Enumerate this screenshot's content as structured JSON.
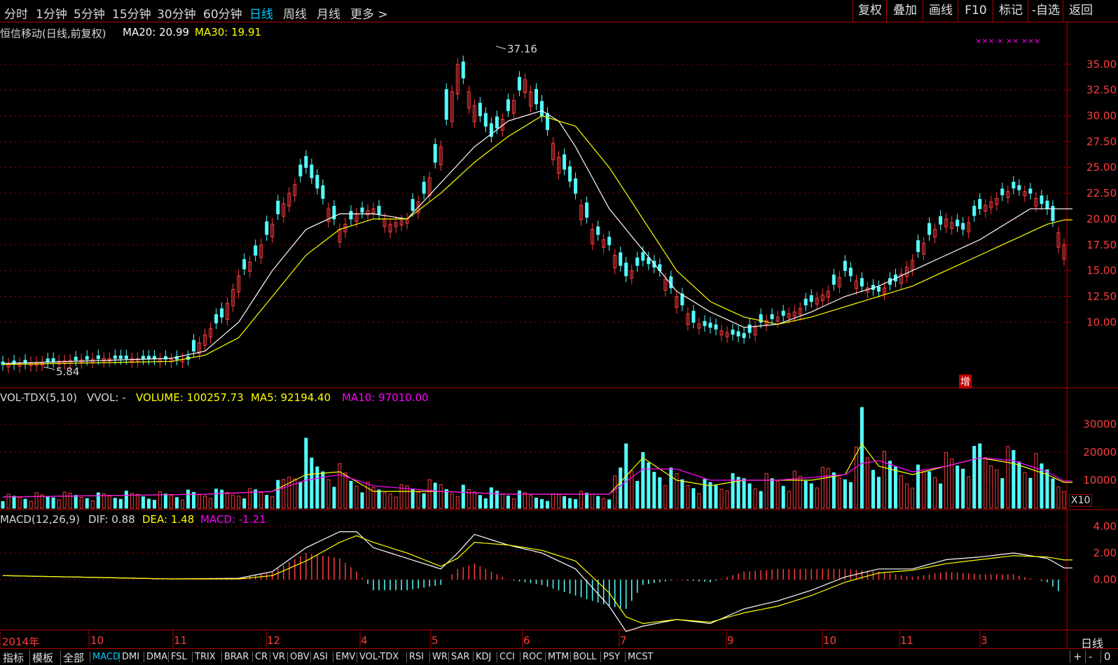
{
  "topbar": {
    "periods": [
      "分时",
      "1分钟",
      "5分钟",
      "15分钟",
      "30分钟",
      "60分钟",
      "日线",
      "周线",
      "月线",
      "更多 >"
    ],
    "active_period": "日线",
    "tools": [
      "复权",
      "叠加",
      "画线",
      "F10",
      "标记",
      "-自选",
      "返回"
    ]
  },
  "price_panel": {
    "title": "恒信移动(日线,前复权)",
    "ma20_label": "MA20: 20.99",
    "ma30_label": "MA30: 19.91",
    "high_label": "37.16",
    "low_label": "5.84",
    "zeng_label": "增",
    "marker_label": "×××  ×  ××  ×××",
    "y_ticks": [
      "35.00",
      "32.50",
      "30.00",
      "27.50",
      "25.00",
      "22.50",
      "20.00",
      "17.50",
      "15.00",
      "12.50",
      "10.00"
    ]
  },
  "vol_panel": {
    "title": "VOL-TDX(5,10)",
    "vvol": "VVOL: -",
    "volume": "VOLUME: 100257.73",
    "ma5": "MA5: 92194.40",
    "ma10": "MA10: 97010.00",
    "y_ticks": [
      "30000",
      "20000",
      "10000"
    ],
    "unit": "X10"
  },
  "macd_panel": {
    "title": "MACD(12,26,9)",
    "dif": "DIF: 0.88",
    "dea": "DEA: 1.48",
    "macd": "MACD: -1.21",
    "y_ticks": [
      "4.00",
      "2.00",
      "0.00"
    ]
  },
  "x_axis": {
    "labels": [
      "2014年",
      "10",
      "11",
      "12",
      "4",
      "5",
      "6",
      "7",
      "9",
      "10",
      "11",
      "3"
    ],
    "period": "日线"
  },
  "bottom_tabs": [
    "指标",
    "模板",
    "全部",
    "MACD",
    "DMI",
    "DMA",
    "FSL",
    "TRIX",
    "BRAR",
    "CR",
    "VR",
    "OBV",
    "ASI",
    "EMV",
    "VOL-TDX",
    "RSI",
    "WR",
    "SAR",
    "KDJ",
    "CCI",
    "ROC",
    "MTM",
    "BOLL",
    "PSY",
    "MCST"
  ],
  "active_tab": "MACD",
  "bottom_right": [
    "+",
    "-",
    "0"
  ],
  "colors": {
    "up": "#ff3c3c",
    "down": "#54ffff",
    "ma20": "#ffffff",
    "ma30": "#ffff00",
    "ma10": "#ff00ff",
    "grid": "#a00000"
  },
  "chart_data": [
    {
      "type": "candlestick",
      "series_name": "恒信移动",
      "ylim": [
        5.84,
        37.16
      ],
      "close_path": [
        [
          0,
          5.9
        ],
        [
          6,
          6.5
        ],
        [
          11,
          6.4
        ],
        [
          12,
          8.8
        ],
        [
          13,
          10.5
        ],
        [
          14,
          14.5
        ],
        [
          15,
          16.5
        ],
        [
          16,
          19.5
        ],
        [
          17,
          22.5
        ],
        [
          18,
          25.0
        ],
        [
          19,
          22.0
        ],
        [
          20,
          19.0
        ],
        [
          21,
          20.5
        ],
        [
          22,
          21.0
        ],
        [
          23,
          19.5
        ],
        [
          24,
          20.0
        ],
        [
          25,
          22.5
        ],
        [
          26,
          27.0
        ],
        [
          26.5,
          31.0
        ],
        [
          27,
          35.0
        ],
        [
          28,
          31.0
        ],
        [
          29,
          28.0
        ],
        [
          30,
          30.5
        ],
        [
          31,
          33.5
        ],
        [
          32,
          30.0
        ],
        [
          33,
          26.0
        ],
        [
          34,
          22.5
        ],
        [
          35,
          19.0
        ],
        [
          36,
          17.5
        ],
        [
          37,
          14.5
        ],
        [
          38,
          16.0
        ],
        [
          39,
          15.0
        ],
        [
          40,
          12.5
        ],
        [
          41,
          10.0
        ],
        [
          42,
          9.5
        ],
        [
          43,
          9.0
        ],
        [
          44,
          8.5
        ],
        [
          45,
          10.0
        ],
        [
          46,
          10.5
        ],
        [
          47,
          11.0
        ],
        [
          48,
          12.0
        ],
        [
          49,
          13.0
        ],
        [
          50,
          15.0
        ],
        [
          51,
          13.5
        ],
        [
          52,
          13.0
        ],
        [
          53,
          14.0
        ],
        [
          54,
          16.0
        ],
        [
          55,
          18.5
        ],
        [
          56,
          20.0
        ],
        [
          57,
          19.0
        ],
        [
          58,
          21.0
        ],
        [
          59,
          22.0
        ],
        [
          60,
          23.0
        ],
        [
          61,
          22.5
        ],
        [
          62,
          21.0
        ],
        [
          63,
          17.5
        ]
      ],
      "ma20_path": [
        [
          0,
          6.0
        ],
        [
          10,
          6.5
        ],
        [
          12,
          7.2
        ],
        [
          14,
          10.0
        ],
        [
          16,
          15.0
        ],
        [
          18,
          19.0
        ],
        [
          20,
          20.5
        ],
        [
          22,
          20.5
        ],
        [
          24,
          20.0
        ],
        [
          26,
          23.5
        ],
        [
          28,
          27.0
        ],
        [
          30,
          29.5
        ],
        [
          32,
          30.5
        ],
        [
          33,
          29.5
        ],
        [
          34,
          27.0
        ],
        [
          35,
          24.0
        ],
        [
          36,
          21.0
        ],
        [
          38,
          17.0
        ],
        [
          40,
          13.0
        ],
        [
          42,
          11.0
        ],
        [
          44,
          9.5
        ],
        [
          46,
          9.8
        ],
        [
          48,
          11.0
        ],
        [
          50,
          12.5
        ],
        [
          52,
          13.5
        ],
        [
          54,
          15.0
        ],
        [
          56,
          16.5
        ],
        [
          58,
          18.0
        ],
        [
          60,
          20.0
        ],
        [
          61,
          21.0
        ],
        [
          62,
          21.0
        ],
        [
          63,
          20.99
        ]
      ],
      "ma30_path": [
        [
          0,
          5.9
        ],
        [
          10,
          6.2
        ],
        [
          12,
          6.8
        ],
        [
          14,
          8.5
        ],
        [
          16,
          12.5
        ],
        [
          18,
          16.5
        ],
        [
          20,
          19.0
        ],
        [
          22,
          20.0
        ],
        [
          24,
          20.0
        ],
        [
          26,
          22.5
        ],
        [
          28,
          25.5
        ],
        [
          30,
          28.0
        ],
        [
          32,
          30.0
        ],
        [
          34,
          29.0
        ],
        [
          36,
          25.0
        ],
        [
          38,
          20.0
        ],
        [
          40,
          15.0
        ],
        [
          42,
          12.0
        ],
        [
          44,
          10.5
        ],
        [
          46,
          9.8
        ],
        [
          48,
          10.5
        ],
        [
          50,
          11.5
        ],
        [
          52,
          12.5
        ],
        [
          54,
          13.5
        ],
        [
          56,
          15.0
        ],
        [
          58,
          16.5
        ],
        [
          60,
          18.0
        ],
        [
          62,
          19.5
        ],
        [
          63,
          19.91
        ]
      ],
      "y_ticks": [
        35,
        32.5,
        30,
        27.5,
        25,
        22.5,
        20,
        17.5,
        15,
        12.5,
        10
      ]
    },
    {
      "type": "bar",
      "series_name": "VOLUME",
      "ylim": [
        0,
        37000
      ],
      "y_ticks": [
        30000,
        20000,
        10000
      ],
      "levels": [
        [
          0,
          4000
        ],
        [
          12,
          5000
        ],
        [
          16,
          6000
        ],
        [
          18,
          15000
        ],
        [
          20,
          12000
        ],
        [
          22,
          6000
        ],
        [
          26,
          8000
        ],
        [
          28,
          6000
        ],
        [
          32,
          4000
        ],
        [
          36,
          5000
        ],
        [
          37,
          18000
        ],
        [
          38,
          15000
        ],
        [
          40,
          10000
        ],
        [
          42,
          8000
        ],
        [
          44,
          10000
        ],
        [
          46,
          10000
        ],
        [
          48,
          10000
        ],
        [
          50,
          13000
        ],
        [
          51,
          20000
        ],
        [
          52,
          16000
        ],
        [
          54,
          12000
        ],
        [
          56,
          15000
        ],
        [
          58,
          17000
        ],
        [
          60,
          18000
        ],
        [
          62,
          13000
        ],
        [
          63,
          10026
        ]
      ],
      "spikes": [
        [
          18,
          25000
        ],
        [
          51,
          36000
        ],
        [
          37,
          23000
        ],
        [
          58,
          23000
        ]
      ],
      "ma5_path": [
        [
          0,
          4000
        ],
        [
          12,
          5000
        ],
        [
          16,
          6000
        ],
        [
          18,
          12000
        ],
        [
          20,
          13000
        ],
        [
          22,
          6000
        ],
        [
          26,
          6000
        ],
        [
          30,
          5000
        ],
        [
          36,
          5000
        ],
        [
          38,
          18000
        ],
        [
          40,
          10000
        ],
        [
          42,
          8000
        ],
        [
          44,
          10000
        ],
        [
          46,
          10000
        ],
        [
          48,
          10000
        ],
        [
          50,
          12000
        ],
        [
          51,
          23000
        ],
        [
          52,
          15000
        ],
        [
          54,
          12000
        ],
        [
          56,
          15000
        ],
        [
          58,
          18000
        ],
        [
          60,
          16000
        ],
        [
          62,
          12000
        ],
        [
          63,
          9219
        ]
      ],
      "ma10_path": [
        [
          0,
          4000
        ],
        [
          12,
          5000
        ],
        [
          16,
          6000
        ],
        [
          18,
          10000
        ],
        [
          20,
          12000
        ],
        [
          22,
          8000
        ],
        [
          26,
          6000
        ],
        [
          30,
          5000
        ],
        [
          36,
          5000
        ],
        [
          38,
          14000
        ],
        [
          40,
          14000
        ],
        [
          42,
          10000
        ],
        [
          44,
          10000
        ],
        [
          46,
          10000
        ],
        [
          48,
          11000
        ],
        [
          50,
          12000
        ],
        [
          51,
          16000
        ],
        [
          52,
          17000
        ],
        [
          54,
          13000
        ],
        [
          56,
          15000
        ],
        [
          58,
          18000
        ],
        [
          60,
          17000
        ],
        [
          62,
          13000
        ],
        [
          63,
          9701
        ]
      ]
    },
    {
      "type": "bar",
      "series_name": "MACD",
      "ylim": [
        -4.0,
        4.8
      ],
      "y_ticks": [
        4,
        2,
        0
      ],
      "dif_path": [
        [
          0,
          0.3
        ],
        [
          10,
          0.05
        ],
        [
          14,
          0.1
        ],
        [
          16,
          0.6
        ],
        [
          18,
          2.4
        ],
        [
          20,
          3.6
        ],
        [
          21,
          3.6
        ],
        [
          22,
          2.4
        ],
        [
          24,
          1.6
        ],
        [
          26,
          0.8
        ],
        [
          27,
          2.0
        ],
        [
          28,
          3.4
        ],
        [
          30,
          2.6
        ],
        [
          32,
          2.0
        ],
        [
          34,
          0.8
        ],
        [
          36,
          -2.0
        ],
        [
          37,
          -3.9
        ],
        [
          38,
          -3.5
        ],
        [
          40,
          -3.0
        ],
        [
          42,
          -3.3
        ],
        [
          44,
          -2.2
        ],
        [
          46,
          -1.6
        ],
        [
          48,
          -0.8
        ],
        [
          50,
          0.2
        ],
        [
          52,
          0.8
        ],
        [
          54,
          0.8
        ],
        [
          56,
          1.5
        ],
        [
          58,
          1.7
        ],
        [
          60,
          2.0
        ],
        [
          62,
          1.6
        ],
        [
          63,
          0.88
        ]
      ],
      "dea_path": [
        [
          0,
          0.3
        ],
        [
          10,
          0.05
        ],
        [
          14,
          0.05
        ],
        [
          16,
          0.3
        ],
        [
          18,
          1.4
        ],
        [
          20,
          2.8
        ],
        [
          21,
          3.3
        ],
        [
          22,
          2.8
        ],
        [
          24,
          2.0
        ],
        [
          26,
          1.0
        ],
        [
          27,
          1.6
        ],
        [
          28,
          2.8
        ],
        [
          30,
          2.6
        ],
        [
          32,
          2.2
        ],
        [
          34,
          1.4
        ],
        [
          36,
          -1.0
        ],
        [
          37,
          -2.8
        ],
        [
          38,
          -3.3
        ],
        [
          40,
          -3.0
        ],
        [
          42,
          -3.2
        ],
        [
          44,
          -2.5
        ],
        [
          46,
          -2.0
        ],
        [
          48,
          -1.2
        ],
        [
          50,
          -0.2
        ],
        [
          52,
          0.5
        ],
        [
          54,
          0.7
        ],
        [
          56,
          1.2
        ],
        [
          58,
          1.5
        ],
        [
          60,
          1.8
        ],
        [
          62,
          1.7
        ],
        [
          63,
          1.48
        ]
      ]
    }
  ]
}
